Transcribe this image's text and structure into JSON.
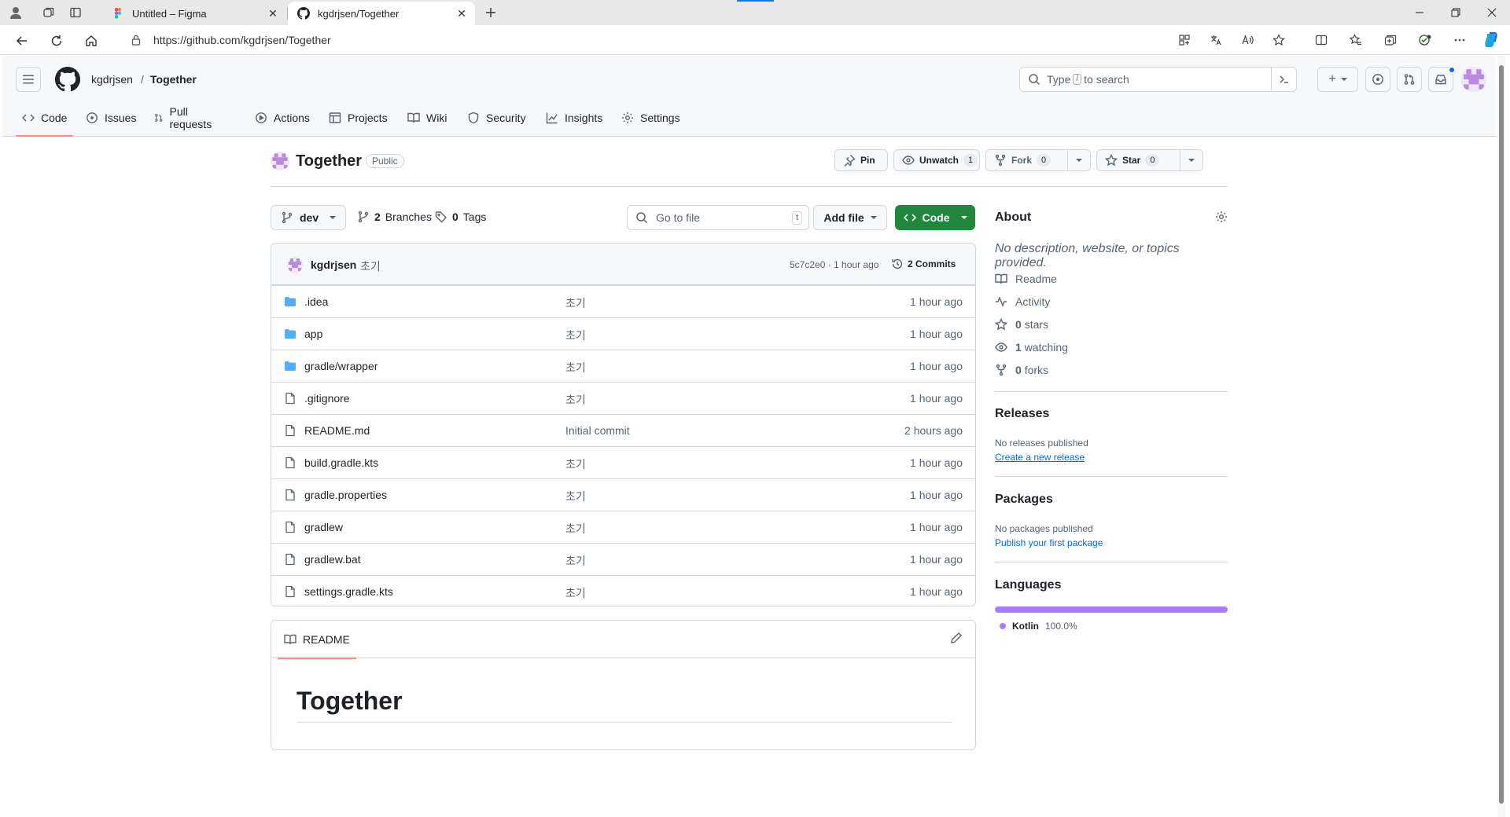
{
  "browser": {
    "tabs": [
      {
        "title": "Untitled – Figma",
        "active": false
      },
      {
        "title": "kgdrjsen/Together",
        "active": true
      }
    ],
    "url": "https://github.com/kgdrjsen/Together"
  },
  "header": {
    "owner": "kgdrjsen",
    "separator": "/",
    "repo": "Together",
    "search_prefix": "Type",
    "search_key": "/",
    "search_suffix": "to search",
    "plus_label": "+"
  },
  "repo_nav": [
    {
      "label": "Code",
      "icon": "code-icon",
      "selected": true
    },
    {
      "label": "Issues",
      "icon": "issue-icon"
    },
    {
      "label": "Pull requests",
      "icon": "pull-request-icon"
    },
    {
      "label": "Actions",
      "icon": "play-icon"
    },
    {
      "label": "Projects",
      "icon": "table-icon"
    },
    {
      "label": "Wiki",
      "icon": "book-icon"
    },
    {
      "label": "Security",
      "icon": "shield-icon"
    },
    {
      "label": "Insights",
      "icon": "graph-icon"
    },
    {
      "label": "Settings",
      "icon": "gear-icon"
    }
  ],
  "repo": {
    "name": "Together",
    "visibility": "Public",
    "pin_label": "Pin",
    "unwatch_label": "Unwatch",
    "watch_count": "1",
    "fork_label": "Fork",
    "fork_count": "0",
    "star_label": "Star",
    "star_count": "0"
  },
  "branch": {
    "name": "dev",
    "branches_count": "2",
    "branches_label": "Branches",
    "tags_count": "0",
    "tags_label": "Tags",
    "goto_placeholder": "Go to file",
    "goto_key": "t",
    "add_file_label": "Add file",
    "code_label": "Code"
  },
  "commit": {
    "author": "kgdrjsen",
    "message": "초기",
    "meta": "5c7c2e0 · 1 hour ago",
    "count_label": "2 Commits"
  },
  "files": [
    {
      "name": ".idea",
      "type": "folder",
      "message": "초기",
      "time": "1 hour ago"
    },
    {
      "name": "app",
      "type": "folder",
      "message": "초기",
      "time": "1 hour ago"
    },
    {
      "name": "gradle/wrapper",
      "type": "folder",
      "message": "초기",
      "time": "1 hour ago"
    },
    {
      "name": ".gitignore",
      "type": "file",
      "message": "초기",
      "time": "1 hour ago"
    },
    {
      "name": "README.md",
      "type": "file",
      "message": "Initial commit",
      "time": "2 hours ago"
    },
    {
      "name": "build.gradle.kts",
      "type": "file",
      "message": "초기",
      "time": "1 hour ago"
    },
    {
      "name": "gradle.properties",
      "type": "file",
      "message": "초기",
      "time": "1 hour ago"
    },
    {
      "name": "gradlew",
      "type": "file",
      "message": "초기",
      "time": "1 hour ago"
    },
    {
      "name": "gradlew.bat",
      "type": "file",
      "message": "초기",
      "time": "1 hour ago"
    },
    {
      "name": "settings.gradle.kts",
      "type": "file",
      "message": "초기",
      "time": "1 hour ago"
    }
  ],
  "readme": {
    "tab_label": "README",
    "heading": "Together"
  },
  "sidebar": {
    "about_title": "About",
    "about_desc": "No description, website, or topics provided.",
    "links": [
      {
        "icon": "book-icon",
        "strong": "",
        "text": "Readme"
      },
      {
        "icon": "pulse-icon",
        "strong": "",
        "text": "Activity"
      },
      {
        "icon": "star-icon",
        "strong": "0",
        "text": "stars"
      },
      {
        "icon": "eye-icon",
        "strong": "1",
        "text": "watching"
      },
      {
        "icon": "fork-icon",
        "strong": "0",
        "text": "forks"
      }
    ],
    "releases_title": "Releases",
    "releases_none": "No releases published",
    "releases_link": "Create a new release",
    "packages_title": "Packages",
    "packages_none": "No packages published",
    "packages_link": "Publish your first package",
    "languages_title": "Languages",
    "language_name": "Kotlin",
    "language_pct": "100.0%",
    "language_color": "#a97bff"
  },
  "colors": {
    "accent_underline": "#fd8c73",
    "code_button": "#1f883d",
    "link": "#0969da",
    "folder": "#54aeff"
  }
}
